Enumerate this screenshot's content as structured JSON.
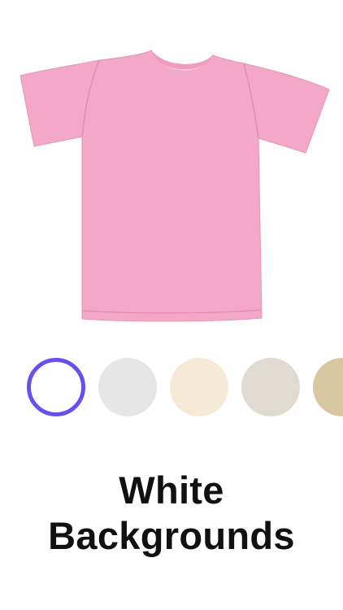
{
  "product": {
    "image_name": "pink-tshirt",
    "shirt_color": "#f4a8c8",
    "collar_inner_color": "#ececec"
  },
  "swatches": [
    {
      "name": "white",
      "color": "#ffffff",
      "selected": true,
      "accent": "#6a4ff0"
    },
    {
      "name": "light-gray",
      "color": "#e6e6e6",
      "selected": false
    },
    {
      "name": "cream",
      "color": "#f4ead6",
      "selected": false
    },
    {
      "name": "warm-gray",
      "color": "#e0dbd2",
      "selected": false
    },
    {
      "name": "tan",
      "color": "#d9c7a1",
      "selected": false
    }
  ],
  "headline": {
    "line1": "White",
    "line2": "Backgrounds"
  }
}
